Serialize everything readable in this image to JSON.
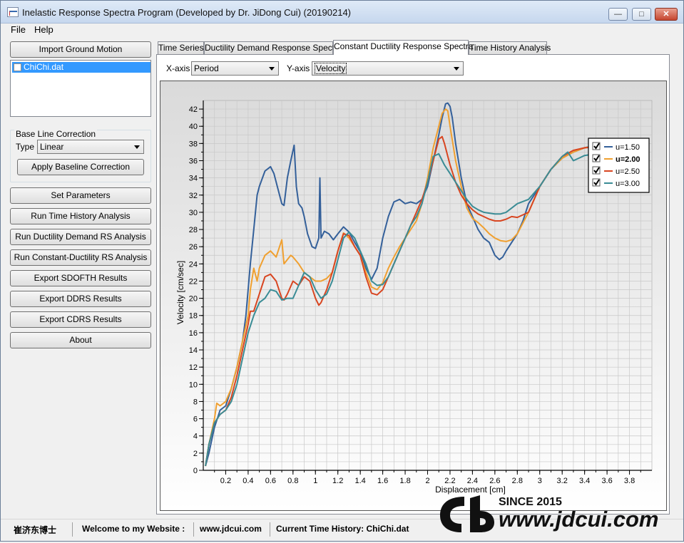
{
  "window": {
    "title": "Inelastic Response Spectra Program (Developed by Dr. JiDong Cui) (20190214)"
  },
  "menu": {
    "file": "File",
    "help": "Help"
  },
  "sidebar": {
    "import_label": "Import Ground Motion",
    "files": [
      {
        "label": "ChiChi.dat",
        "checked": false,
        "selected": true
      }
    ],
    "baseline": {
      "group_title": "Base Line Correction",
      "type_label": "Type",
      "type_value": "Linear",
      "apply_label": "Apply Baseline Correction"
    },
    "buttons": [
      "Set Parameters",
      "Run Time History Analysis",
      "Run Ductility Demand RS Analysis",
      "Run Constant-Ductility RS Analysis",
      "Export SDOFTH Results",
      "Export DDRS Results",
      "Export CDRS Results",
      "About"
    ]
  },
  "tabs": [
    {
      "label": "Time Series",
      "active": false
    },
    {
      "label": "Ductility Demand Response Spectra",
      "active": false
    },
    {
      "label": "Constant Ductility Response Spectra",
      "active": true
    },
    {
      "label": "Time History Analysis",
      "active": false
    }
  ],
  "controls": {
    "xaxis_label": "X-axis",
    "xaxis_value": "Period",
    "yaxis_label": "Y-axis",
    "yaxis_value": "Velocity"
  },
  "chart_data": {
    "type": "line",
    "xlabel": "Displacement [cm]",
    "ylabel": "Velocity [cm/sec]",
    "xlim": [
      0,
      4.0
    ],
    "ylim": [
      0,
      43
    ],
    "xticks": [
      0.2,
      0.4,
      0.6,
      0.8,
      1,
      1.2,
      1.4,
      1.6,
      1.8,
      2,
      2.2,
      2.4,
      2.6,
      2.8,
      3,
      3.2,
      3.4,
      3.6,
      3.8
    ],
    "yticks": [
      0,
      2,
      4,
      6,
      8,
      10,
      12,
      14,
      16,
      18,
      20,
      22,
      24,
      26,
      28,
      30,
      32,
      34,
      36,
      38,
      40,
      42
    ],
    "grid": true,
    "legend_position": "top-right",
    "series": [
      {
        "name": "u=1.50",
        "color": "#34609a",
        "checked": true,
        "bold": false,
        "x": [
          0.02,
          0.05,
          0.1,
          0.15,
          0.2,
          0.25,
          0.3,
          0.35,
          0.38,
          0.42,
          0.45,
          0.48,
          0.5,
          0.55,
          0.6,
          0.63,
          0.66,
          0.7,
          0.72,
          0.75,
          0.78,
          0.81,
          0.83,
          0.85,
          0.88,
          0.9,
          0.93,
          0.97,
          1.0,
          1.03,
          1.04,
          1.05,
          1.08,
          1.12,
          1.16,
          1.2,
          1.25,
          1.3,
          1.35,
          1.4,
          1.45,
          1.5,
          1.55,
          1.6,
          1.65,
          1.7,
          1.75,
          1.8,
          1.85,
          1.9,
          1.95,
          2.0,
          2.05,
          2.1,
          2.13,
          2.16,
          2.18,
          2.2,
          2.22,
          2.25,
          2.3,
          2.35,
          2.4,
          2.45,
          2.5,
          2.55,
          2.6,
          2.64,
          2.67,
          2.7,
          2.75,
          2.8,
          2.85,
          2.9,
          3.0,
          3.1,
          3.2,
          3.3,
          3.4,
          3.5
        ],
        "values": [
          0.5,
          2,
          5,
          7,
          7.5,
          9.5,
          12,
          15,
          18,
          24,
          28,
          32,
          33,
          34.8,
          35.3,
          34.5,
          33,
          31,
          30.8,
          34,
          36,
          37.8,
          33,
          31,
          30.5,
          29.5,
          27.5,
          26,
          25.8,
          27,
          34,
          27,
          27.8,
          27.5,
          26.8,
          27.5,
          28.3,
          27.7,
          26.5,
          25.4,
          23.5,
          22.2,
          23.5,
          27,
          29.5,
          31.2,
          31.5,
          31,
          31.2,
          31,
          31.5,
          33,
          36,
          39,
          41,
          42.6,
          42.7,
          42.3,
          41,
          38,
          34,
          31,
          29.5,
          28,
          27,
          26.5,
          25,
          24.5,
          24.8,
          25.5,
          26.5,
          27.5,
          29,
          31,
          33,
          35,
          36.3,
          37,
          37.5,
          37.8
        ]
      },
      {
        "name": "u=2.00",
        "color": "#f0a030",
        "checked": true,
        "bold": true,
        "x": [
          0.02,
          0.05,
          0.1,
          0.12,
          0.15,
          0.2,
          0.25,
          0.3,
          0.35,
          0.4,
          0.42,
          0.45,
          0.48,
          0.5,
          0.55,
          0.6,
          0.65,
          0.7,
          0.72,
          0.75,
          0.78,
          0.8,
          0.85,
          0.9,
          0.95,
          1.0,
          1.05,
          1.1,
          1.15,
          1.2,
          1.25,
          1.3,
          1.35,
          1.4,
          1.45,
          1.5,
          1.55,
          1.6,
          1.65,
          1.7,
          1.75,
          1.8,
          1.85,
          1.9,
          1.95,
          2.0,
          2.05,
          2.1,
          2.13,
          2.16,
          2.18,
          2.2,
          2.25,
          2.3,
          2.35,
          2.4,
          2.45,
          2.5,
          2.55,
          2.6,
          2.65,
          2.7,
          2.75,
          2.8,
          2.9,
          3.0,
          3.1,
          3.2,
          3.3,
          3.4,
          3.5
        ],
        "values": [
          0.5,
          3,
          6,
          7.8,
          7.5,
          8,
          9.5,
          12,
          15,
          18,
          21,
          23.5,
          22,
          23.5,
          25,
          25.5,
          24.8,
          26.8,
          24,
          24.5,
          25,
          24.8,
          24,
          23,
          22.5,
          22,
          22,
          22.3,
          23,
          25.5,
          27.6,
          27,
          26,
          25,
          23,
          21.3,
          21,
          21.8,
          23.5,
          24.8,
          26,
          27,
          28,
          29,
          31,
          34,
          37.5,
          40,
          41.5,
          42,
          41.8,
          40,
          36,
          33,
          30.5,
          29.3,
          28.8,
          28.2,
          27.5,
          27,
          26.7,
          26.6,
          26.8,
          27.5,
          30,
          33,
          35,
          36.3,
          37,
          37.5,
          37.7
        ]
      },
      {
        "name": "u=2.50",
        "color": "#d84520",
        "checked": true,
        "bold": false,
        "x": [
          0.02,
          0.05,
          0.1,
          0.15,
          0.2,
          0.25,
          0.3,
          0.35,
          0.4,
          0.42,
          0.45,
          0.5,
          0.55,
          0.6,
          0.65,
          0.7,
          0.72,
          0.75,
          0.8,
          0.85,
          0.9,
          0.95,
          1.0,
          1.03,
          1.05,
          1.1,
          1.15,
          1.2,
          1.25,
          1.3,
          1.35,
          1.4,
          1.45,
          1.5,
          1.55,
          1.6,
          1.65,
          1.7,
          1.75,
          1.8,
          1.85,
          1.9,
          1.95,
          2.0,
          2.05,
          2.1,
          2.13,
          2.15,
          2.2,
          2.25,
          2.3,
          2.35,
          2.4,
          2.45,
          2.5,
          2.55,
          2.6,
          2.65,
          2.7,
          2.75,
          2.8,
          2.9,
          3.0,
          3.1,
          3.2,
          3.3,
          3.4,
          3.5
        ],
        "values": [
          0.5,
          3,
          5.5,
          6.5,
          7,
          8.5,
          11,
          14,
          17,
          18.5,
          18.5,
          20.5,
          22.5,
          22.8,
          22,
          20,
          19.8,
          20.5,
          22,
          21.5,
          22.5,
          22,
          20,
          19.2,
          19.5,
          21,
          23,
          25.5,
          27.5,
          27.3,
          26,
          25,
          22.5,
          20.6,
          20.4,
          21,
          22.5,
          24,
          25.5,
          27,
          28.5,
          30,
          31.5,
          33.5,
          36,
          38.5,
          38.8,
          38,
          35.5,
          33.5,
          32,
          31,
          30.3,
          29.8,
          29.5,
          29.2,
          29,
          29,
          29.2,
          29.5,
          29.4,
          30,
          33,
          35,
          36.5,
          37.2,
          37.5,
          37.6
        ]
      },
      {
        "name": "u=3.00",
        "color": "#3a8c95",
        "checked": true,
        "bold": false,
        "x": [
          0.02,
          0.05,
          0.1,
          0.15,
          0.2,
          0.25,
          0.3,
          0.35,
          0.4,
          0.45,
          0.5,
          0.55,
          0.6,
          0.65,
          0.7,
          0.75,
          0.8,
          0.85,
          0.9,
          0.95,
          1.0,
          1.05,
          1.1,
          1.15,
          1.2,
          1.25,
          1.3,
          1.35,
          1.4,
          1.45,
          1.5,
          1.55,
          1.6,
          1.65,
          1.7,
          1.75,
          1.8,
          1.85,
          1.9,
          1.95,
          2.0,
          2.05,
          2.1,
          2.15,
          2.2,
          2.25,
          2.3,
          2.35,
          2.4,
          2.45,
          2.5,
          2.55,
          2.6,
          2.65,
          2.7,
          2.75,
          2.8,
          2.9,
          3.0,
          3.1,
          3.2,
          3.25,
          3.3,
          3.35,
          3.4,
          3.5
        ],
        "values": [
          0.5,
          3,
          5.5,
          6.5,
          7,
          8,
          10,
          13,
          16,
          18,
          19.5,
          20,
          21,
          20.8,
          19.8,
          20,
          20,
          21.5,
          23,
          22.5,
          21,
          20,
          20.5,
          22,
          24.5,
          27,
          27.7,
          27,
          25.5,
          24,
          22,
          21.5,
          21.6,
          22.5,
          24,
          25.5,
          27,
          28.5,
          29.5,
          31,
          33.5,
          36.5,
          36.8,
          35.5,
          34.5,
          33.5,
          32.5,
          31.5,
          30.7,
          30.3,
          30,
          29.9,
          29.8,
          29.8,
          30,
          30.5,
          31,
          31.5,
          33,
          35,
          36.5,
          37,
          36,
          36.3,
          36.6,
          36.8
        ]
      }
    ]
  },
  "status": {
    "author": "崔济东博士",
    "welcome": "Welcome to my Website :",
    "website": "www.jdcui.com",
    "current": "Current Time History: ChiChi.dat"
  },
  "watermark": {
    "since": "SINCE 2015",
    "url": "www.jdcui.com"
  }
}
